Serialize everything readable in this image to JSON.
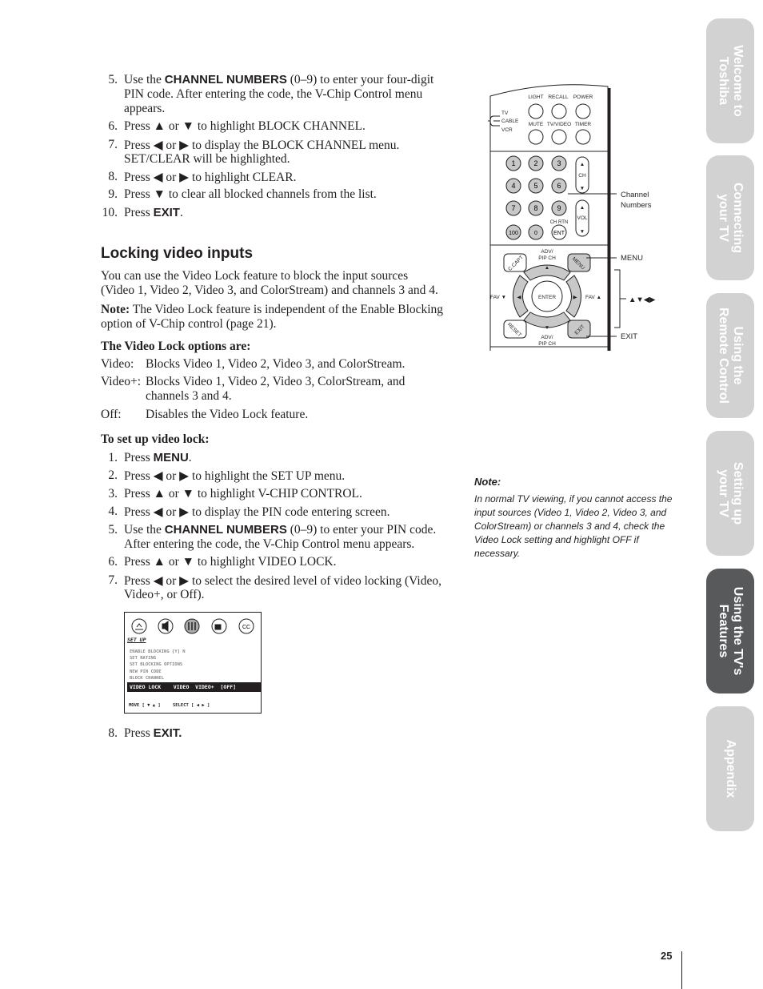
{
  "steps_top": [
    {
      "n": "5.",
      "lines": [
        [
          "Use the ",
          "CHANNEL NUMBERS",
          " (0–9) to enter your four-digit"
        ],
        [
          "PIN code. After entering the code, the V-Chip Control menu"
        ],
        [
          "appears."
        ]
      ]
    },
    {
      "n": "6.",
      "text": "Press ▲ or ▼ to highlight BLOCK CHANNEL."
    },
    {
      "n": "7.",
      "text": "Press ◀ or ▶ to display the BLOCK CHANNEL menu.",
      "text2": "SET/CLEAR will be highlighted."
    },
    {
      "n": "8.",
      "text": "Press ◀ or ▶ to highlight CLEAR."
    },
    {
      "n": "9.",
      "text": "Press ▼ to clear all blocked channels from the list."
    },
    {
      "n": "10.",
      "text": "Press ",
      "key": "EXIT",
      "after": "."
    }
  ],
  "section": {
    "title": "Locking video inputs",
    "intro": [
      "You can use the Video Lock feature to block the input sources",
      "(Video 1, Video 2, Video 3, and ColorStream) and channels 3 and 4."
    ],
    "note_label": "Note:",
    "note": [
      " The Video Lock feature is independent of the Enable Blocking",
      "option of V-Chip control (page 21)."
    ],
    "options_heading": "The Video Lock options are:",
    "options": [
      {
        "k": "Video:",
        "v": [
          "Blocks Video 1, Video 2, Video 3, and ColorStream."
        ]
      },
      {
        "k": "Video+:",
        "v": [
          "Blocks Video 1, Video 2, Video 3, ColorStream, and",
          "channels 3 and 4."
        ]
      },
      {
        "k": "Off:",
        "v": [
          "Disables the Video Lock feature."
        ]
      }
    ],
    "setup_heading": "To set up video lock:",
    "steps": [
      {
        "n": "1.",
        "pre": "Press ",
        "key": "MENU",
        "post": "."
      },
      {
        "n": "2.",
        "pre": "Press ◀ or ▶ to highlight the SET UP menu."
      },
      {
        "n": "3.",
        "pre": "Press ▲ or ▼ to highlight V-CHIP CONTROL."
      },
      {
        "n": "4.",
        "pre": "Press ◀ or ▶ to display the PIN code entering screen."
      },
      {
        "n": "5.",
        "pre": "Use the ",
        "key": "CHANNEL NUMBERS",
        "post": " (0–9) to enter your PIN code.",
        "l2": "After entering the code, the V-Chip Control menu appears."
      },
      {
        "n": "6.",
        "pre": "Press ▲ or ▼ to highlight VIDEO LOCK."
      },
      {
        "n": "7.",
        "pre": "Press ◀ or ▶ to select the desired level of video locking (Video,",
        "l2": "Video+, or Off)."
      },
      {
        "n": "8.",
        "pre": "Press ",
        "key": "EXIT."
      }
    ]
  },
  "menu_screen": {
    "icons": [
      "picture-icon",
      "audio-icon",
      "setup-icon",
      "camera-icon",
      "cc-icon"
    ],
    "title": "SET UP",
    "items": [
      "ENABLE BLOCKING  [Y] N",
      "SET RATING",
      "SET BLOCKING OPTIONS",
      "NEW PIN CODE",
      "BLOCK CHANNEL"
    ],
    "highlight": "VIDEO LOCK    VIDEO  VIDEO+  [OFF]",
    "footer_move": "MOVE [ ▼ ▲ ]",
    "footer_select": "SELECT [ ◀  ▶ ]"
  },
  "remote": {
    "top_labels": [
      "LIGHT",
      "RECALL",
      "POWER"
    ],
    "mid_labels": [
      "MUTE",
      "TV/VIDEO",
      "TIMER"
    ],
    "mode": [
      "TV",
      "CABLE",
      "VCR"
    ],
    "digits": [
      "1",
      "2",
      "3",
      "4",
      "5",
      "6",
      "7",
      "8",
      "9",
      "100",
      "0",
      "ENT"
    ],
    "ch": "CH",
    "vol": "VOL",
    "ch_rtn": "CH RTN",
    "adv_top": [
      "ADV/",
      "PIP CH"
    ],
    "adv_bottom": [
      "ADV/",
      "PIP CH"
    ],
    "ccapt": "C.CAPT",
    "menu": "MENU",
    "reset": "RESET",
    "exit": "EXIT",
    "enter": "ENTER",
    "fav_left": "FAV ▼",
    "fav_right": "FAV ▲",
    "callouts": {
      "channel": [
        "Channel",
        "Numbers"
      ],
      "menu": "MENU",
      "arrows": "▲▼◀▶",
      "exit": "EXIT"
    }
  },
  "side_note": {
    "label": "Note:",
    "lines": [
      "In normal TV viewing, if you cannot access the",
      "input sources (Video 1, Video 2, Video 3, and",
      "ColorStream) or channels 3 and 4, check the",
      "Video Lock setting and highlight OFF if",
      "necessary."
    ]
  },
  "tabs": [
    {
      "label": "Welcome to\nToshiba",
      "active": false
    },
    {
      "label": "Connecting\nyour TV",
      "active": false
    },
    {
      "label": "Using the\nRemote Control",
      "active": false
    },
    {
      "label": "Setting up\nyour TV",
      "active": false
    },
    {
      "label": "Using the TV's\nFeatures",
      "active": true
    },
    {
      "label": "Appendix",
      "active": false
    }
  ],
  "page_number": "25",
  "colors": {
    "tab_inactive": "#d2d2d3",
    "tab_active": "#58595b",
    "button_gray": "#c8c8c8"
  }
}
